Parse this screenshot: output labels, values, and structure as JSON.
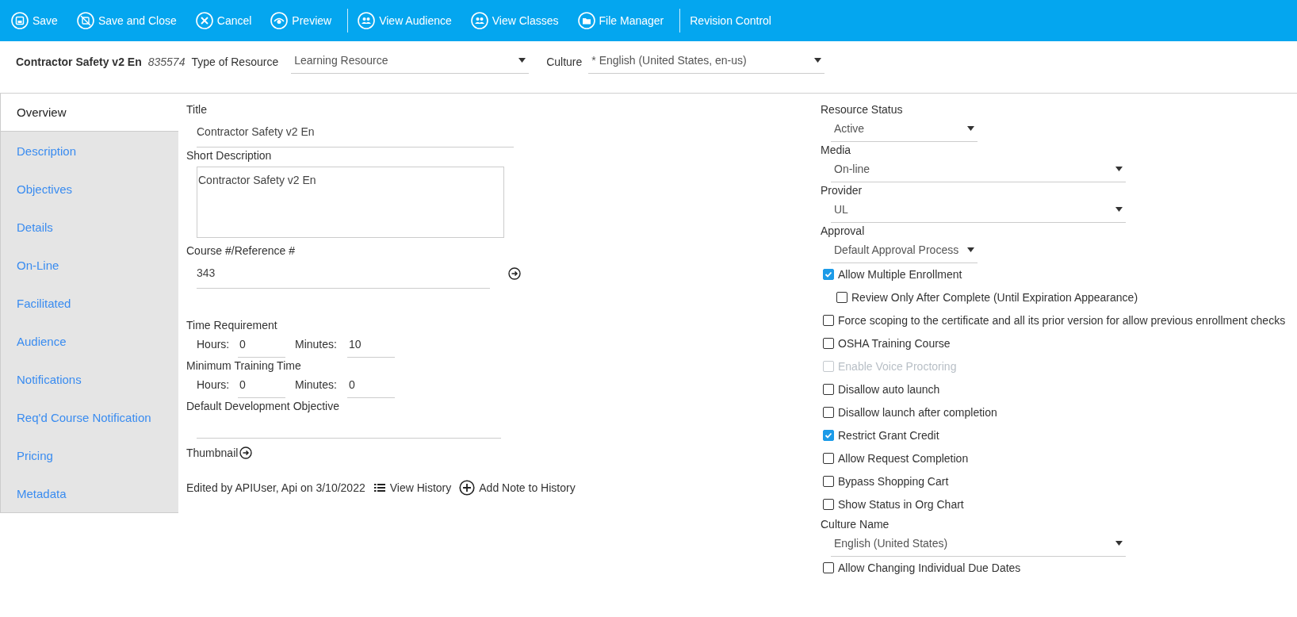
{
  "toolbar": {
    "groups": [
      [
        {
          "label": "Save"
        },
        {
          "label": "Save and Close"
        },
        {
          "label": "Cancel"
        },
        {
          "label": "Preview"
        }
      ],
      [
        {
          "label": "View Audience"
        },
        {
          "label": "View Classes"
        },
        {
          "label": "File Manager"
        }
      ],
      [
        {
          "label": "Revision Control"
        }
      ]
    ]
  },
  "header": {
    "title": "Contractor Safety v2 En",
    "id": "835574",
    "type_label": "Type of Resource",
    "type_value": "Learning Resource",
    "culture_label": "Culture",
    "culture_value": "* English (United States, en-us)"
  },
  "sidebar": {
    "items": [
      {
        "label": "Overview",
        "selected": true
      },
      {
        "label": "Description",
        "selected": false
      },
      {
        "label": "Objectives",
        "selected": false
      },
      {
        "label": "Details",
        "selected": false
      },
      {
        "label": "On-Line",
        "selected": false
      },
      {
        "label": "Facilitated",
        "selected": false
      },
      {
        "label": "Audience",
        "selected": false
      },
      {
        "label": "Notifications",
        "selected": false
      },
      {
        "label": "Req'd Course Notification",
        "selected": false
      },
      {
        "label": "Pricing",
        "selected": false
      },
      {
        "label": "Metadata",
        "selected": false
      }
    ]
  },
  "form": {
    "title_label": "Title",
    "title_value": "Contractor Safety v2 En",
    "short_description_label": "Short Description",
    "short_description_value": "Contractor Safety v2 En",
    "reference_label": "Course #/Reference #",
    "reference_value": "343",
    "time_groups": [
      {
        "label": "Time Requirement",
        "hours_label": "Hours:",
        "hours": "0",
        "minutes_label": "Minutes:",
        "minutes": "10"
      },
      {
        "label": "Minimum Training Time",
        "hours_label": "Hours:",
        "hours": "0",
        "minutes_label": "Minutes:",
        "minutes": "0"
      }
    ],
    "objective_label": "Default Development Objective",
    "thumbnail_label": "Thumbnail",
    "edited_text": "Edited by APIUser, Api on 3/10/2022",
    "view_history": "View History",
    "add_note": "Add Note to History"
  },
  "settings": [
    {
      "kind": "select",
      "label": "Resource Status",
      "value": "Active",
      "compact": true
    },
    {
      "kind": "select",
      "label": "Media",
      "value": "On-line",
      "compact": false
    },
    {
      "kind": "select",
      "label": "Provider",
      "value": "UL",
      "compact": false
    },
    {
      "kind": "select",
      "label": "Approval",
      "value": "Default Approval Process",
      "compact": true
    },
    {
      "kind": "checkbox",
      "label": "Allow Multiple Enrollment",
      "checked": true,
      "disabled": false,
      "children": [
        {
          "label": "Review Only After Complete (Until Expiration Appearance)",
          "checked": false,
          "disabled": false
        }
      ]
    },
    {
      "kind": "checkbox",
      "label": "Force scoping to the certificate and all its prior version for allow previous enrollment checks",
      "checked": false,
      "disabled": false
    },
    {
      "kind": "checkbox",
      "label": "OSHA Training Course",
      "checked": false,
      "disabled": false
    },
    {
      "kind": "checkbox",
      "label": "Enable Voice Proctoring",
      "checked": false,
      "disabled": true
    },
    {
      "kind": "checkbox",
      "label": "Disallow auto launch",
      "checked": false,
      "disabled": false
    },
    {
      "kind": "checkbox",
      "label": "Disallow launch after completion",
      "checked": false,
      "disabled": false
    },
    {
      "kind": "checkbox",
      "label": "Restrict Grant Credit",
      "checked": true,
      "disabled": false
    },
    {
      "kind": "checkbox",
      "label": "Allow Request Completion",
      "checked": false,
      "disabled": false
    },
    {
      "kind": "checkbox",
      "label": "Bypass Shopping Cart",
      "checked": false,
      "disabled": false
    },
    {
      "kind": "checkbox",
      "label": "Show Status in Org Chart",
      "checked": false,
      "disabled": false
    },
    {
      "kind": "select",
      "label": "Culture Name",
      "value": "English (United States)",
      "compact": false
    },
    {
      "kind": "checkbox",
      "label": "Allow Changing Individual Due Dates",
      "checked": false,
      "disabled": false
    }
  ]
}
